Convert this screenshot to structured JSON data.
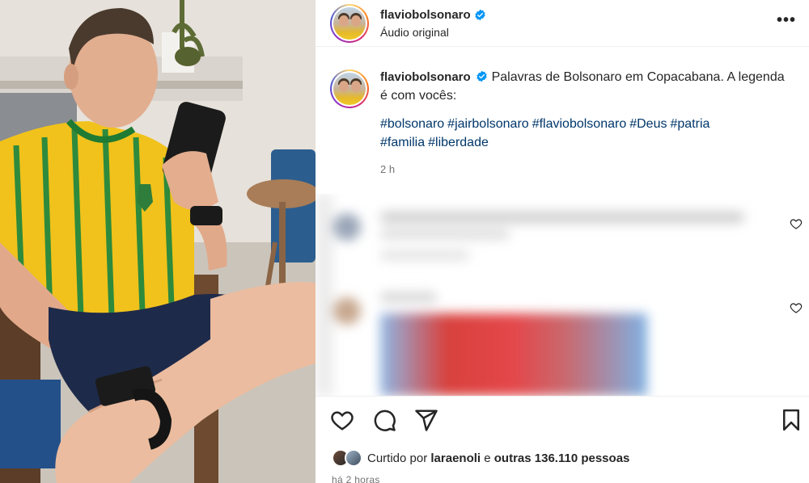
{
  "post": {
    "username": "flaviobolsonaro",
    "audio_label": "Áudio original",
    "more_label": "•••",
    "caption_text": "Palavras de Bolsonaro em Copacabana. A legenda é com vocês:",
    "hashtags": [
      "#bolsonaro",
      "#jairbolsonaro",
      "#flaviobolsonaro",
      "#Deus",
      "#patria",
      "#familia",
      "#liberdade"
    ],
    "caption_time": "2 h",
    "likes_prefix": "Curtido por",
    "likes_user": "laraenoli",
    "likes_mid": "e",
    "likes_count": "outras 136.110 pessoas",
    "posted_ago": "há 2 horas"
  },
  "icons": {
    "verified": "verified-badge-icon",
    "like": "heart-icon",
    "comment": "comment-icon",
    "share": "paper-plane-icon",
    "save": "bookmark-icon",
    "comment_like": "heart-outline-icon"
  },
  "colors": {
    "hashtag": "#00376b",
    "verified": "#0095f6",
    "muted": "#737373",
    "text": "#262626"
  }
}
